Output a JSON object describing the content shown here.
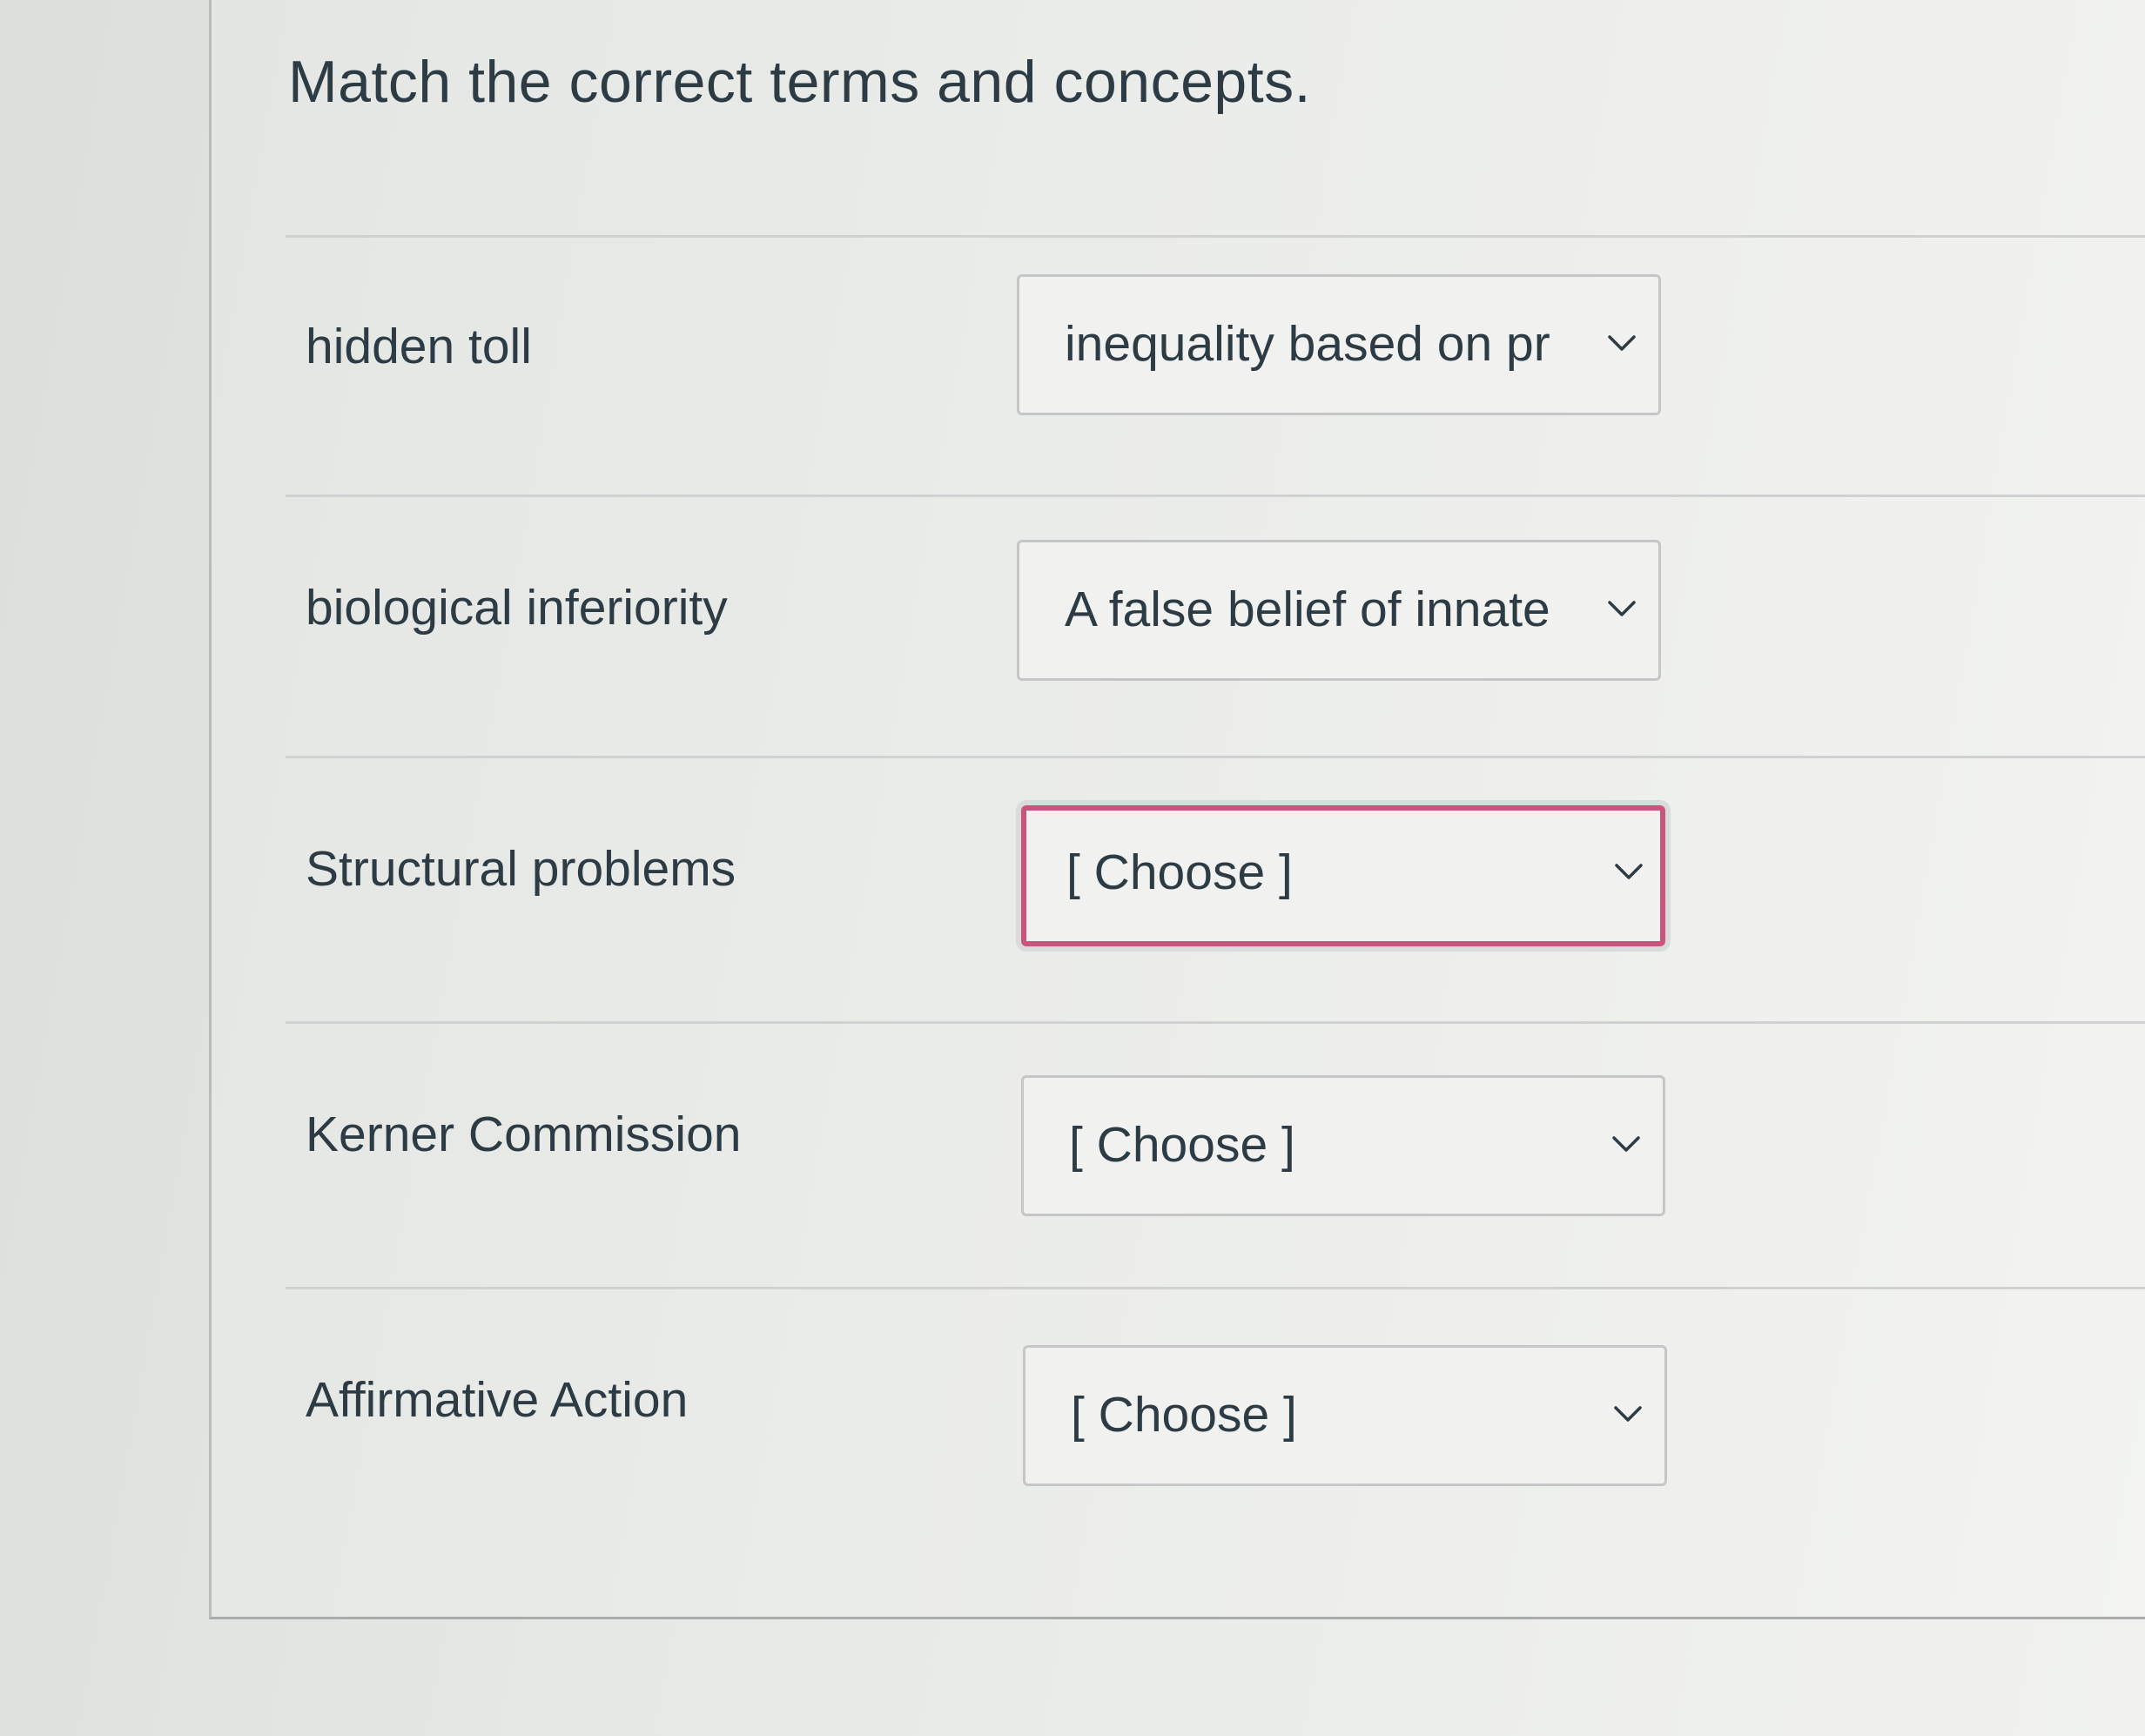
{
  "question": {
    "title": "Match the correct terms and concepts."
  },
  "rows": [
    {
      "term": "hidden toll",
      "selected": "inequality based on pr",
      "focused": false
    },
    {
      "term": "biological inferiority",
      "selected": "A false belief of innate",
      "focused": false
    },
    {
      "term": "Structural problems",
      "selected": "[ Choose ]",
      "focused": true
    },
    {
      "term": "Kerner Commission",
      "selected": "[ Choose ]",
      "focused": false
    },
    {
      "term": "Affirmative Action",
      "selected": "[ Choose ]",
      "focused": false
    }
  ],
  "icons": {
    "dropdown": "chevron-down-icon"
  },
  "colors": {
    "text": "#2d3b45",
    "focus_border": "#c9557f",
    "select_border": "#c4c7c5",
    "background": "#e6e8e5"
  }
}
